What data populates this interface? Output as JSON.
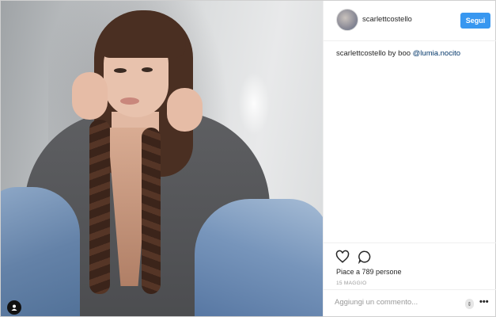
{
  "header": {
    "username": "scarlettcostello",
    "follow_label": "Segui"
  },
  "caption": {
    "author": "scarlettcostello",
    "text": " by boo ",
    "mention": "@lumia.nocito"
  },
  "actions": {
    "like_icon": "heart-icon",
    "comment_icon": "comment-icon",
    "likes_text": "Piace a 789 persone",
    "date": "15 MAGGIO"
  },
  "comment": {
    "placeholder": "Aggiungi un commento...",
    "more_label": "•••"
  },
  "colors": {
    "follow_button": "#3897f0",
    "mention": "#003569",
    "muted_text": "#999999"
  }
}
